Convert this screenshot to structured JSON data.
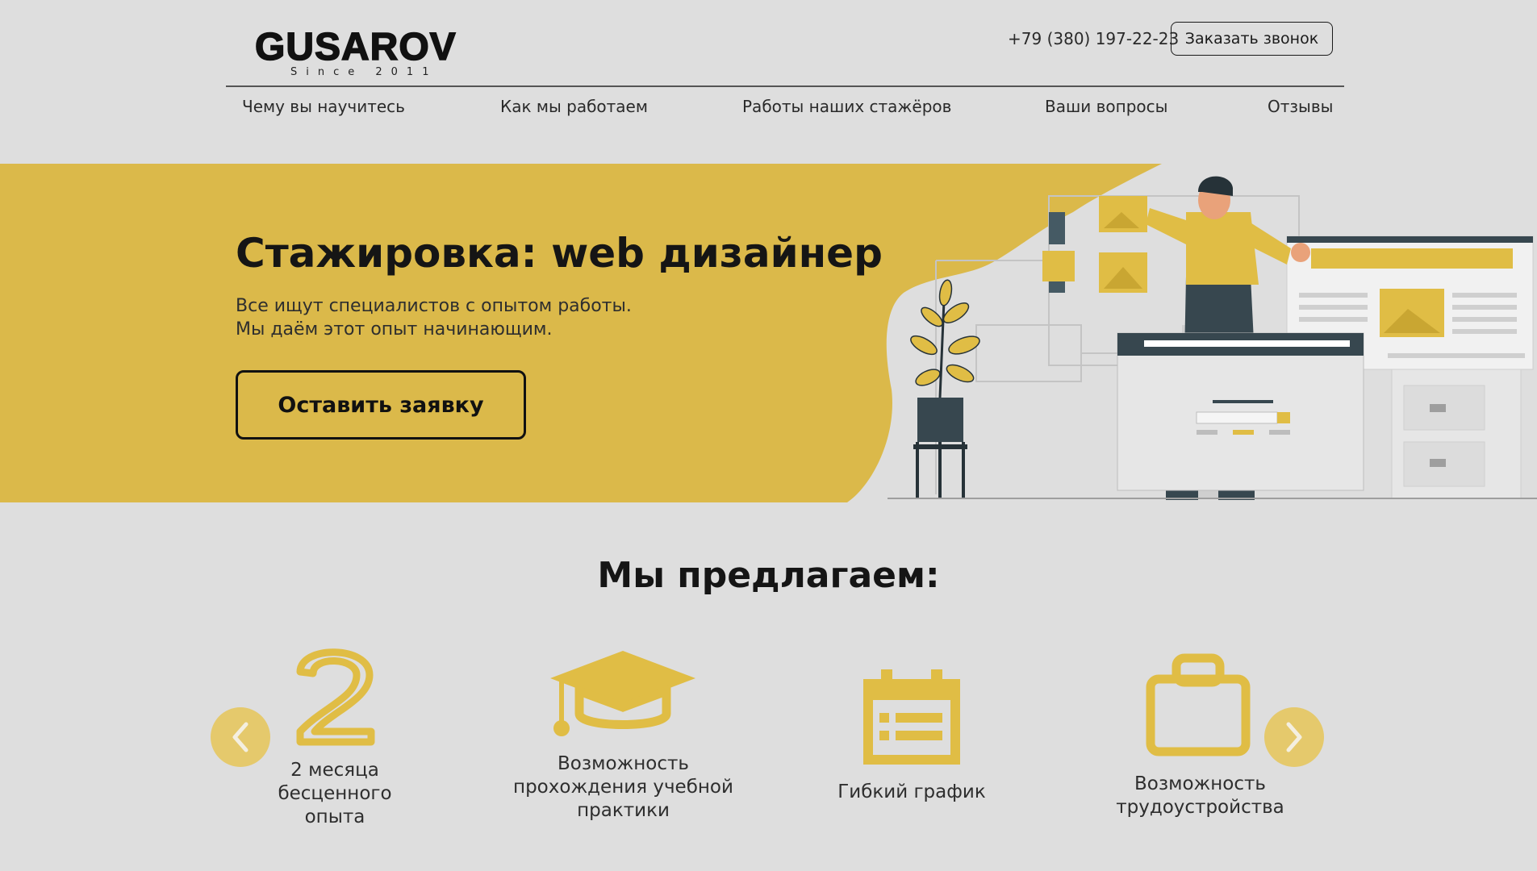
{
  "header": {
    "logo_text": "GUSAROV",
    "logo_since": "Since 2011",
    "phone": "+79 (380) 197-22-23",
    "call_button": "Заказать звонок"
  },
  "nav": [
    {
      "label": "Чему вы научитесь"
    },
    {
      "label": "Как мы работаем"
    },
    {
      "label": "Работы наших стажёров"
    },
    {
      "label": "Ваши вопросы"
    },
    {
      "label": "Отзывы"
    }
  ],
  "hero": {
    "title": "Стажировка: web дизайнер",
    "subtitle_line1": "Все ищут специалистов с опытом работы.",
    "subtitle_line2": "Мы даём этот опыт начинающим.",
    "cta": "Оставить заявку"
  },
  "offers": {
    "title": "Мы предлагаем:",
    "items": [
      {
        "icon": "number-two-icon",
        "label_lines": [
          "2 месяца",
          "бесценного",
          "опыта"
        ]
      },
      {
        "icon": "graduation-cap-icon",
        "label_lines": [
          "Возможность",
          "прохождения учебной",
          "практики"
        ]
      },
      {
        "icon": "calendar-icon",
        "label_lines": [
          "Гибкий график"
        ]
      },
      {
        "icon": "briefcase-icon",
        "label_lines": [
          "Возможность",
          "трудоустройства"
        ]
      }
    ]
  },
  "colors": {
    "background": "#dedede",
    "accent_yellow": "#dbb94a",
    "icon_yellow": "#e0bd45",
    "arrow_bg": "#e5c96c",
    "dark_slate": "#37474f"
  }
}
